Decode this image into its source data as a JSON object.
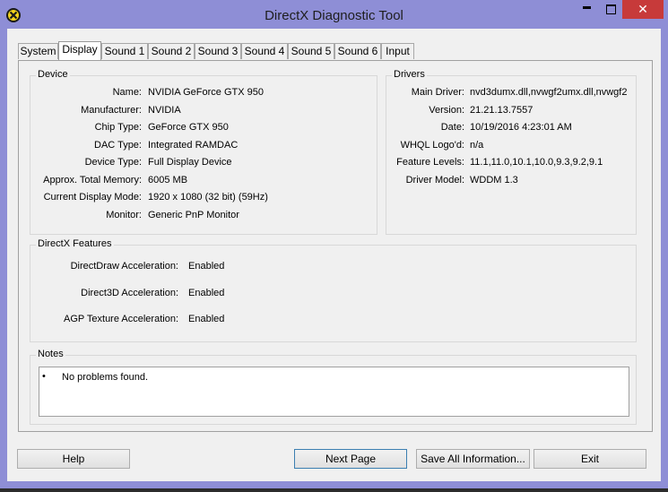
{
  "window": {
    "title": "DirectX Diagnostic Tool",
    "close_glyph": "✕"
  },
  "tabs": [
    "System",
    "Display",
    "Sound 1",
    "Sound 2",
    "Sound 3",
    "Sound 4",
    "Sound 5",
    "Sound 6",
    "Input"
  ],
  "active_tab": "Display",
  "device": {
    "title": "Device",
    "rows": [
      {
        "label": "Name:",
        "value": "NVIDIA GeForce GTX 950"
      },
      {
        "label": "Manufacturer:",
        "value": "NVIDIA"
      },
      {
        "label": "Chip Type:",
        "value": "GeForce GTX 950"
      },
      {
        "label": "DAC Type:",
        "value": "Integrated RAMDAC"
      },
      {
        "label": "Device Type:",
        "value": "Full Display Device"
      },
      {
        "label": "Approx. Total Memory:",
        "value": "6005 MB"
      },
      {
        "label": "Current Display Mode:",
        "value": "1920 x 1080 (32 bit) (59Hz)"
      },
      {
        "label": "Monitor:",
        "value": "Generic PnP Monitor"
      }
    ]
  },
  "drivers": {
    "title": "Drivers",
    "rows": [
      {
        "label": "Main Driver:",
        "value": "nvd3dumx.dll,nvwgf2umx.dll,nvwgf2"
      },
      {
        "label": "Version:",
        "value": "21.21.13.7557"
      },
      {
        "label": "Date:",
        "value": "10/19/2016 4:23:01 AM"
      },
      {
        "label": "WHQL Logo'd:",
        "value": "n/a"
      },
      {
        "label": "Feature Levels:",
        "value": "11.1,11.0,10.1,10.0,9.3,9.2,9.1"
      },
      {
        "label": "Driver Model:",
        "value": "WDDM 1.3"
      }
    ]
  },
  "features": {
    "title": "DirectX Features",
    "rows": [
      {
        "label": "DirectDraw Acceleration:",
        "value": "Enabled"
      },
      {
        "label": "Direct3D Acceleration:",
        "value": "Enabled"
      },
      {
        "label": "AGP Texture Acceleration:",
        "value": "Enabled"
      }
    ]
  },
  "notes": {
    "title": "Notes",
    "bullet": "•",
    "text": "No problems found."
  },
  "buttons": {
    "help": "Help",
    "next": "Next Page",
    "save": "Save All Information...",
    "exit": "Exit"
  },
  "colors": {
    "titlebar": "#8e8ed6",
    "close": "#c73a3a",
    "client": "#f0f0f0"
  }
}
